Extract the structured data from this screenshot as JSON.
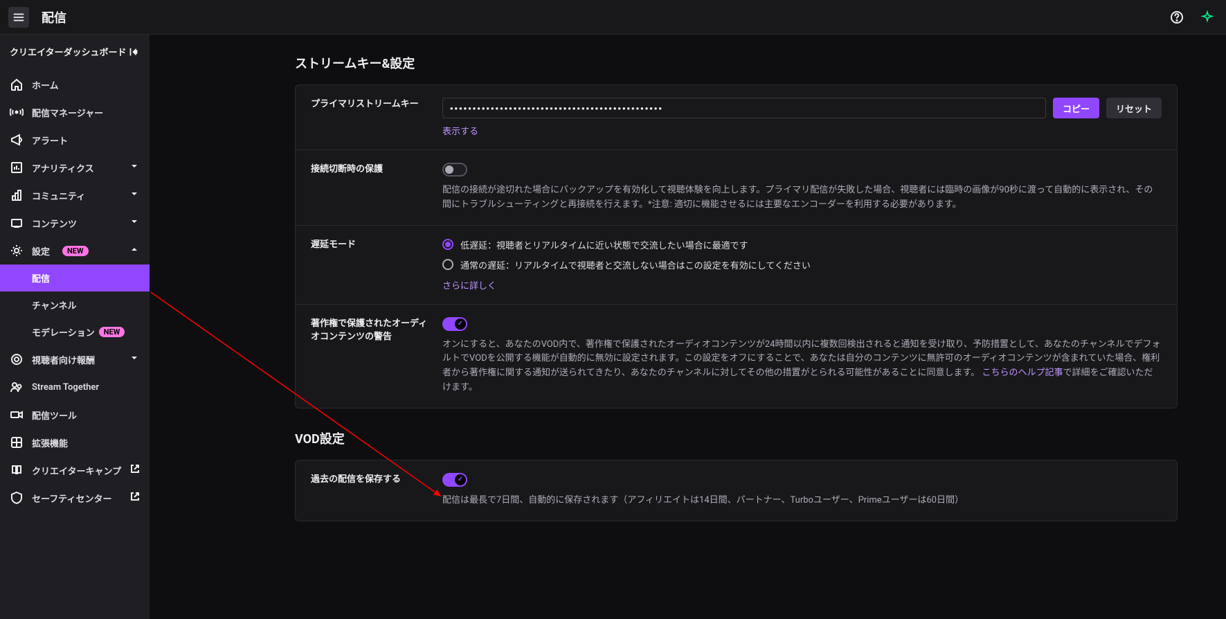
{
  "topbar": {
    "title": "配信"
  },
  "sidebar": {
    "header": "クリエイターダッシュボード",
    "items": {
      "home": "ホーム",
      "stream_manager": "配信マネージャー",
      "alerts": "アラート",
      "analytics": "アナリティクス",
      "community": "コミュニティ",
      "content": "コンテンツ",
      "settings": "設定",
      "settings_badge": "NEW",
      "sub_stream": "配信",
      "sub_channel": "チャンネル",
      "sub_moderation": "モデレーション",
      "sub_moderation_badge": "NEW",
      "viewer_rewards": "視聴者向け報酬",
      "stream_together": "Stream Together",
      "broadcast_tools": "配信ツール",
      "extensions": "拡張機能",
      "creator_camp": "クリエイターキャンプ",
      "safety_center": "セーフティセンター"
    }
  },
  "main": {
    "section1_title": "ストリームキー&設定",
    "primary_key_label": "プライマリストリームキー",
    "primary_key_value": "•••••••••••••••••••••••••••••••••••••••••••••••",
    "copy_btn": "コピー",
    "reset_btn": "リセット",
    "show_link": "表示する",
    "disconnect_label": "接続切断時の保護",
    "disconnect_desc": "配信の接続が途切れた場合にバックアップを有効化して視聴体験を向上します。プライマリ配信が失敗した場合、視聴者には臨時の画像が90秒に渡って自動的に表示され、その間にトラブルシューティングと再接続を行えます。*注意: 適切に機能させるには主要なエンコーダーを利用する必要があります。",
    "latency_label": "遅延モード",
    "latency_low": "低遅延：視聴者とリアルタイムに近い状態で交流したい場合に最適です",
    "latency_normal": "通常の遅延：リアルタイムで視聴者と交流しない場合はこの設定を有効にしてください",
    "latency_more": "さらに詳しく",
    "copyright_label": "著作権で保護されたオーディオコンテンツの警告",
    "copyright_desc_1": "オンにすると、あなたのVOD内で、著作権で保護されたオーディオコンテンツが24時間以内に複数回検出されると通知を受け取り、予防措置として、あなたのチャンネルでデフォルトでVODを公開する機能が自動的に無効に設定されます。この設定をオフにすることで、あなたは自分のコンテンツに無許可のオーディオコンテンツが含まれていた場合、権利者から著作権に関する通知が送られてきたり、あなたのチャンネルに対してその他の措置がとられる可能性があることに同意します。",
    "copyright_link": "こちらのヘルプ記事",
    "copyright_desc_2": "で詳細をご確認いただけます。",
    "section2_title": "VOD設定",
    "save_past_label": "過去の配信を保存する",
    "save_past_desc": "配信は最長で7日間、自動的に保存されます（アフィリエイトは14日間、パートナー、Turboユーザー、Primeユーザーは60日間）"
  }
}
